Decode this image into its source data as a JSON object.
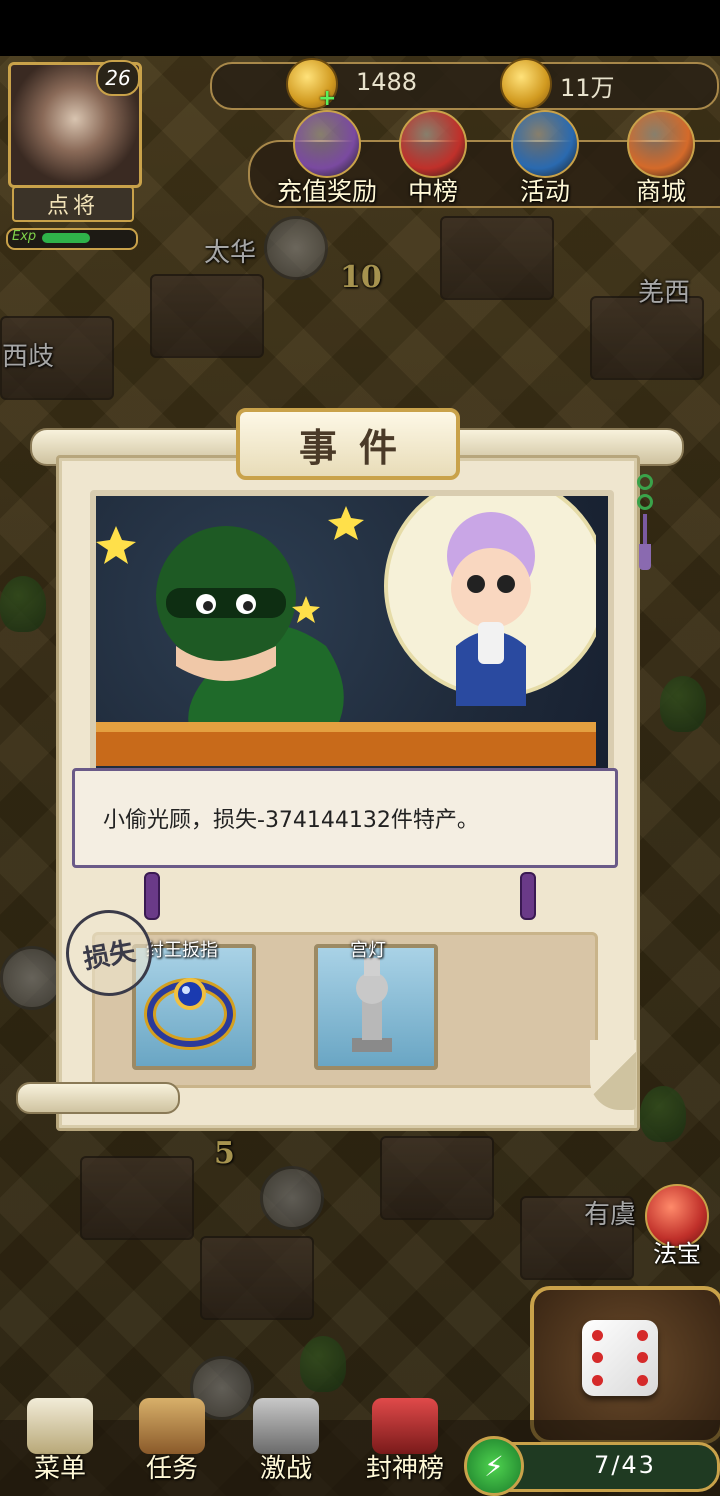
{
  "player": {
    "level": "26",
    "general_button": "点将",
    "exp_label": "Exp",
    "exp_fraction": 0.55
  },
  "resources": {
    "gold": "1488",
    "treasure": "11万"
  },
  "top_menu": [
    {
      "label": "充值奖励",
      "icon": "recharge-reward-icon",
      "color": "#7a4aa0"
    },
    {
      "label": "中榜",
      "icon": "ranking-icon",
      "color": "#c0302a"
    },
    {
      "label": "活动",
      "icon": "event-drum-icon",
      "color": "#2a6ab0"
    },
    {
      "label": "商城",
      "icon": "shop-icon",
      "color": "#d46a2a"
    }
  ],
  "map_labels": {
    "taihua": "太华",
    "xiqi": "西歧",
    "qiangxi": "羌西",
    "youyu": "有虞"
  },
  "map_tiles": {
    "tile_10": "10",
    "tile_5": "5"
  },
  "event": {
    "title": "事件",
    "message": "小偷光顾，损失-374144132件特产。",
    "loss_stamp": "损失",
    "items": [
      {
        "name": "纣王扳指",
        "icon": "ring-icon"
      },
      {
        "name": "宫灯",
        "icon": "palace-lantern-icon"
      }
    ]
  },
  "fabao": {
    "label": "法宝"
  },
  "bottom_nav": [
    {
      "label": "菜单",
      "icon": "menu-scroll-icon"
    },
    {
      "label": "任务",
      "icon": "task-icon"
    },
    {
      "label": "激战",
      "icon": "battle-icon"
    },
    {
      "label": "封神榜",
      "icon": "fengshen-list-icon"
    }
  ],
  "steps": {
    "text": "7/43",
    "current": 7,
    "total": 43
  },
  "colors": {
    "gold_border": "#c9a24a",
    "dialog_bg": "#efe6cf",
    "exp_green": "#2fb34a",
    "stamp": "#3a3a48"
  }
}
